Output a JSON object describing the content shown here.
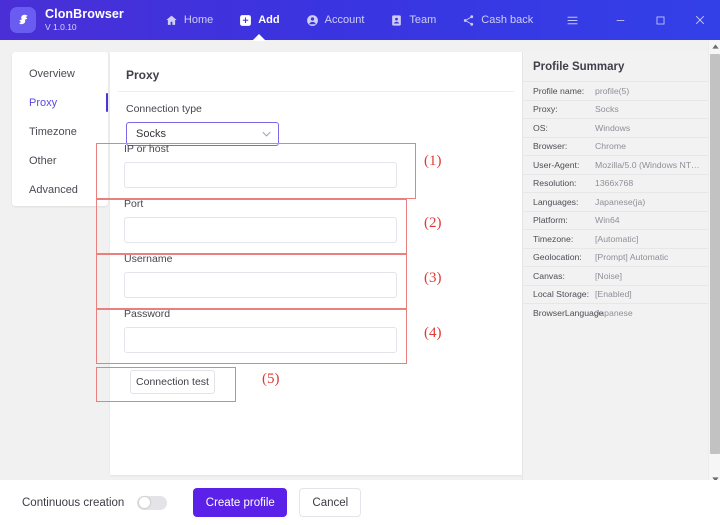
{
  "titlebar": {
    "brand_name": "ClonBrowser",
    "version": "V 1.0.10",
    "nav": [
      {
        "label": "Home",
        "icon": "home-icon",
        "active": false
      },
      {
        "label": "Add",
        "icon": "add-icon",
        "active": true
      },
      {
        "label": "Account",
        "icon": "account-icon",
        "active": false
      },
      {
        "label": "Team",
        "icon": "team-icon",
        "active": false
      },
      {
        "label": "Cash back",
        "icon": "share-icon",
        "active": false
      }
    ],
    "window_controls": [
      {
        "name": "menu-button",
        "glyph": "☰"
      },
      {
        "name": "minimize-button",
        "glyph": "—"
      },
      {
        "name": "maximize-button",
        "glyph": "□"
      },
      {
        "name": "close-button",
        "glyph": "✕"
      }
    ]
  },
  "sidebar": {
    "items": [
      {
        "label": "Overview",
        "active": false
      },
      {
        "label": "Proxy",
        "active": true
      },
      {
        "label": "Timezone",
        "active": false
      },
      {
        "label": "Other",
        "active": false
      },
      {
        "label": "Advanced",
        "active": false
      }
    ]
  },
  "main": {
    "section_title": "Proxy",
    "connection_type": {
      "label": "Connection type",
      "value": "Socks",
      "chevron": "∨"
    },
    "fields": [
      {
        "label": "IP or host",
        "value": "",
        "placeholder": "",
        "annotation": "(1)"
      },
      {
        "label": "Port",
        "value": "",
        "placeholder": "",
        "annotation": "(2)"
      },
      {
        "label": "Username",
        "value": "",
        "placeholder": "",
        "annotation": "(3)"
      },
      {
        "label": "Password",
        "value": "",
        "placeholder": "",
        "annotation": "(4)"
      }
    ],
    "connection_test": {
      "label": "Connection test",
      "annotation": "(5)"
    }
  },
  "summary": {
    "title": "Profile Summary",
    "rows": [
      {
        "key": "Profile name:",
        "value": "profile(5)"
      },
      {
        "key": "Proxy:",
        "value": "Socks"
      },
      {
        "key": "OS:",
        "value": "Windows"
      },
      {
        "key": "Browser:",
        "value": "Chrome"
      },
      {
        "key": "User-Agent:",
        "value": "Mozilla/5.0 (Windows NT 1..."
      },
      {
        "key": "Resolution:",
        "value": "1366x768"
      },
      {
        "key": "Languages:",
        "value": "Japanese(ja)"
      },
      {
        "key": "Platform:",
        "value": "Win64"
      },
      {
        "key": "Timezone:",
        "value": "[Automatic]"
      },
      {
        "key": "Geolocation:",
        "value": "[Prompt] Automatic"
      },
      {
        "key": "Canvas:",
        "value": "[Noise]"
      },
      {
        "key": "Local Storage:",
        "value": "[Enabled]"
      },
      {
        "key": "BrowserLanguage",
        "value": "Japanese"
      }
    ]
  },
  "bottombar": {
    "continuous_label": "Continuous creation",
    "toggle_on": false,
    "create_label": "Create profile",
    "cancel_label": "Cancel"
  },
  "colors": {
    "header_purple": "#3a34e0",
    "accent_purple": "#5b21e8",
    "active_item": "#5b4ae0",
    "annotation_red": "#e03a36",
    "annotation_border": "#e8807f"
  },
  "scrollbar": {
    "up_glyph": "▲",
    "down_glyph": "▼"
  }
}
